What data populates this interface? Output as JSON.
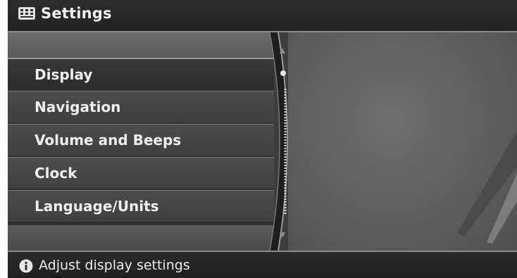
{
  "header": {
    "title": "Settings",
    "icon": "settings-keypad-icon"
  },
  "menu": {
    "items": [
      {
        "label": "Display",
        "selected": true
      },
      {
        "label": "Navigation",
        "selected": false
      },
      {
        "label": "Volume and Beeps",
        "selected": false
      },
      {
        "label": "Clock",
        "selected": false
      },
      {
        "label": "Language/Units",
        "selected": false
      }
    ]
  },
  "footer": {
    "icon": "info-icon",
    "text": "Adjust display settings"
  },
  "colors": {
    "background": "#3d3d3d",
    "header": "#2c2c2c",
    "text": "#efefef",
    "divider": "#8a8a8a"
  }
}
